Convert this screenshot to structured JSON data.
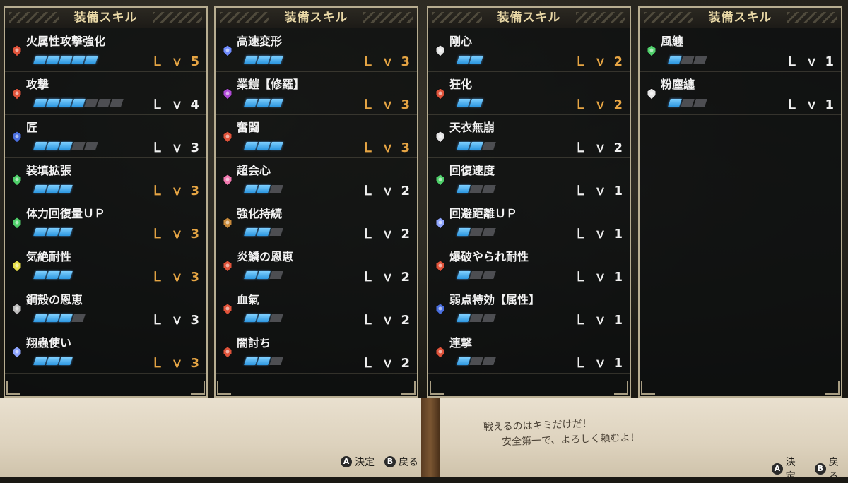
{
  "panels": [
    {
      "title": "装備スキル",
      "skills": [
        {
          "name": "火属性攻撃強化",
          "level": "5",
          "max": 5,
          "icon_color": "#e0533a",
          "maxed": true
        },
        {
          "name": "攻撃",
          "level": "4",
          "max": 7,
          "icon_color": "#e0533a",
          "maxed": false
        },
        {
          "name": "匠",
          "level": "3",
          "max": 5,
          "icon_color": "#4a6fe0",
          "maxed": false
        },
        {
          "name": "装填拡張",
          "level": "3",
          "max": 3,
          "icon_color": "#4fd06a",
          "maxed": true
        },
        {
          "name": "体力回復量ＵＰ",
          "level": "3",
          "max": 3,
          "icon_color": "#4fd06a",
          "maxed": true
        },
        {
          "name": "気絶耐性",
          "level": "3",
          "max": 3,
          "icon_color": "#e8e04a",
          "maxed": true
        },
        {
          "name": "鋼殻の恩恵",
          "level": "3",
          "max": 4,
          "icon_color": "#bdbdbd",
          "maxed": false
        },
        {
          "name": "翔蟲使い",
          "level": "3",
          "max": 3,
          "icon_color": "#8fa6ff",
          "maxed": true
        }
      ]
    },
    {
      "title": "装備スキル",
      "skills": [
        {
          "name": "高速変形",
          "level": "3",
          "max": 3,
          "icon_color": "#6f8cff",
          "maxed": true
        },
        {
          "name": "業鎧【修羅】",
          "level": "3",
          "max": 3,
          "icon_color": "#b04ad8",
          "maxed": true
        },
        {
          "name": "奮闘",
          "level": "3",
          "max": 3,
          "icon_color": "#e0533a",
          "maxed": true
        },
        {
          "name": "超会心",
          "level": "2",
          "max": 3,
          "icon_color": "#f27ab0",
          "maxed": false
        },
        {
          "name": "強化持続",
          "level": "2",
          "max": 3,
          "icon_color": "#c98a3a",
          "maxed": false
        },
        {
          "name": "炎鱗の恩恵",
          "level": "2",
          "max": 3,
          "icon_color": "#e0533a",
          "maxed": false
        },
        {
          "name": "血氣",
          "level": "2",
          "max": 3,
          "icon_color": "#e0533a",
          "maxed": false
        },
        {
          "name": "闇討ち",
          "level": "2",
          "max": 3,
          "icon_color": "#e0533a",
          "maxed": false
        }
      ]
    },
    {
      "title": "装備スキル",
      "skills": [
        {
          "name": "剛心",
          "level": "2",
          "max": 2,
          "icon_color": "#e6e6e6",
          "maxed": true
        },
        {
          "name": "狂化",
          "level": "2",
          "max": 2,
          "icon_color": "#e0533a",
          "maxed": true
        },
        {
          "name": "天衣無崩",
          "level": "2",
          "max": 3,
          "icon_color": "#e6e6e6",
          "maxed": false
        },
        {
          "name": "回復速度",
          "level": "1",
          "max": 3,
          "icon_color": "#4fd06a",
          "maxed": false
        },
        {
          "name": "回避距離ＵＰ",
          "level": "1",
          "max": 3,
          "icon_color": "#8fa6ff",
          "maxed": false
        },
        {
          "name": "爆破やられ耐性",
          "level": "1",
          "max": 3,
          "icon_color": "#e0533a",
          "maxed": false
        },
        {
          "name": "弱点特効【属性】",
          "level": "1",
          "max": 3,
          "icon_color": "#4a6fe0",
          "maxed": false
        },
        {
          "name": "連撃",
          "level": "1",
          "max": 3,
          "icon_color": "#e0533a",
          "maxed": false
        }
      ]
    },
    {
      "title": "装備スキル",
      "skills": [
        {
          "name": "風纏",
          "level": "1",
          "max": 3,
          "icon_color": "#4fd06a",
          "maxed": false
        },
        {
          "name": "粉塵纏",
          "level": "1",
          "max": 3,
          "icon_color": "#e6e6e6",
          "maxed": false
        }
      ]
    }
  ],
  "lv_label": "Ｌｖ",
  "paper_notes": [
    "戦えるのはキミだけだ！",
    "安全第一で、よろしく頼むよ！"
  ],
  "hints": {
    "confirm_btn": "A",
    "confirm_label": "決定",
    "back_btn": "B",
    "back_label": "戻る"
  }
}
